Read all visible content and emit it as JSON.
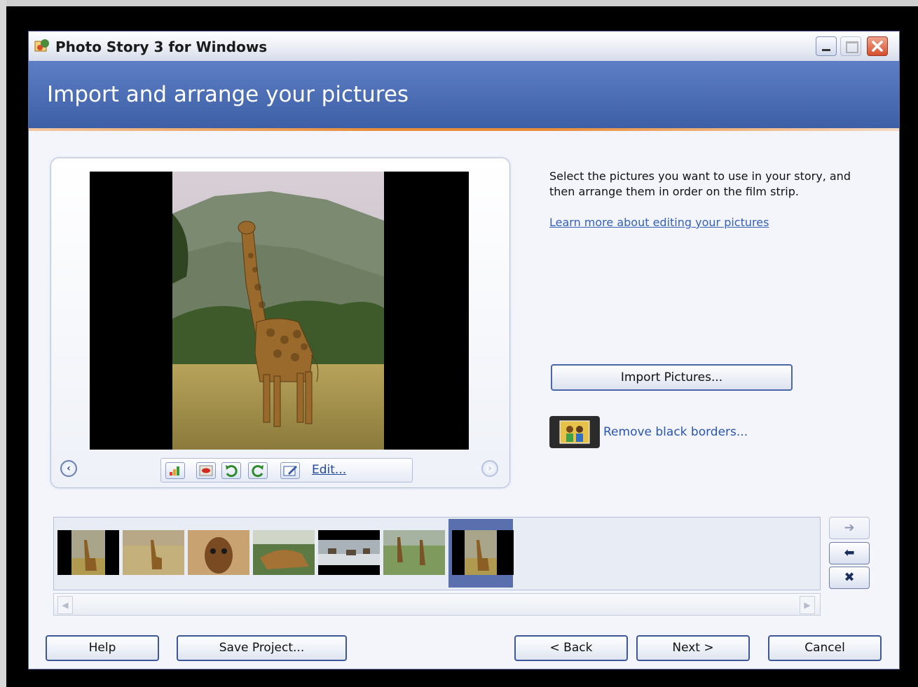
{
  "window": {
    "title": "Photo Story 3 for Windows",
    "title_icon": "photo-story-icon",
    "controls": [
      "minimize-icon",
      "maximize-icon",
      "close-icon"
    ]
  },
  "header": {
    "title": "Import and arrange your pictures",
    "band_color": "#4a6db5",
    "accent_rule_color": "#e88d3a"
  },
  "preview": {
    "tools": [
      "auto-correct-icon",
      "red-eye-icon",
      "rotate-left-icon",
      "rotate-right-icon",
      "edit-icon"
    ],
    "edit_label": "Edit..."
  },
  "right_panel": {
    "instructions": "Select the pictures you want to use in your story, and then arrange them in order on the film strip.",
    "learn_link": "Learn more about editing your pictures",
    "import_button": "Import Pictures...",
    "remove_borders_link": "Remove black borders..."
  },
  "filmstrip": {
    "thumbnails": [
      "giraffe-thumbnail",
      "giraffe-savanna-thumbnail",
      "giraffe-closeup-thumbnail",
      "giraffe-head-thumbnail",
      "herd-at-waterhole-thumbnail",
      "giraffes-group-thumbnail",
      "giraffe-thumbnail-selected"
    ],
    "selected_index": 6
  },
  "footer": {
    "help": "Help",
    "save": "Save Project...",
    "back": "< Back",
    "next": "Next >",
    "cancel": "Cancel"
  }
}
